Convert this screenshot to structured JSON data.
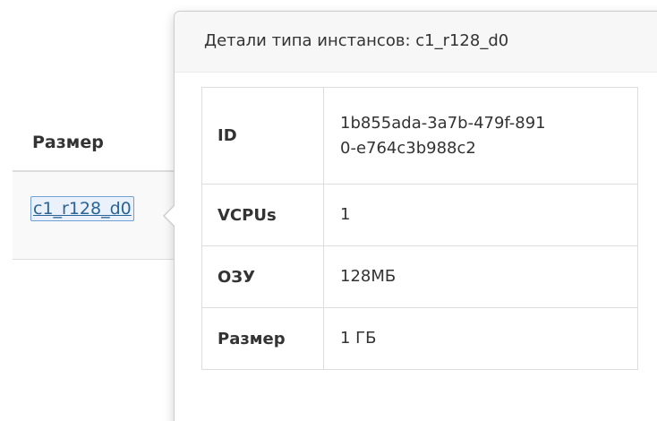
{
  "background_table": {
    "header": "Размер",
    "link": "c1_r128_d0"
  },
  "popover": {
    "title": "Детали типа инстансов: c1_r128_d0",
    "rows": [
      {
        "key": "ID",
        "value_lines": [
          "1b855ada-3a7b-479f-891",
          "0-e764c3b988c2"
        ]
      },
      {
        "key": "VCPUs",
        "value": "1"
      },
      {
        "key": "ОЗУ",
        "value": "128МБ"
      },
      {
        "key": "Размер",
        "value": "1 ГБ"
      }
    ]
  }
}
